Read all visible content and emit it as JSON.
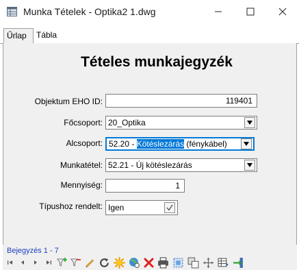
{
  "window": {
    "title": "Munka Tételek - Optika2 1.dwg"
  },
  "tabs": [
    {
      "label": "Űrlap"
    },
    {
      "label": "Tábla"
    }
  ],
  "form": {
    "title": "Tételes munkajegyzék",
    "fields": {
      "eho": {
        "label": "Objektum EHO ID:",
        "value": "119401"
      },
      "focsoport": {
        "label": "Főcsoport:",
        "value": "20_Optika"
      },
      "alcsoport": {
        "label": "Alcsoport:",
        "prefix": "52.20 - ",
        "selected": "Kötéslezárás",
        "suffix": " (fénykábel)"
      },
      "munkatetel": {
        "label": "Munkatétel:",
        "value": "52.21 - Új kötéslezárás"
      },
      "mennyiseg": {
        "label": "Mennyiség:",
        "value": "1"
      },
      "tipushoz": {
        "label": "Típushoz rendelt:",
        "value": "Igen"
      }
    }
  },
  "record": {
    "label": "Bejegyzés 1 - 7"
  },
  "toolbar": {
    "icons": [
      "first-record-icon",
      "prev-record-icon",
      "next-record-icon",
      "last-record-icon",
      "add-filter-icon",
      "remove-filter-icon",
      "edit-icon",
      "refresh-icon",
      "highlight-icon",
      "zoom-to-icon",
      "delete-icon",
      "print-icon",
      "select-icon",
      "copy-icon",
      "move-icon",
      "table-icon",
      "exit-icon"
    ]
  },
  "colors": {
    "accent": "#0078d7",
    "form_bg": "#f0f0f0",
    "record_text": "#1a3fc0"
  }
}
